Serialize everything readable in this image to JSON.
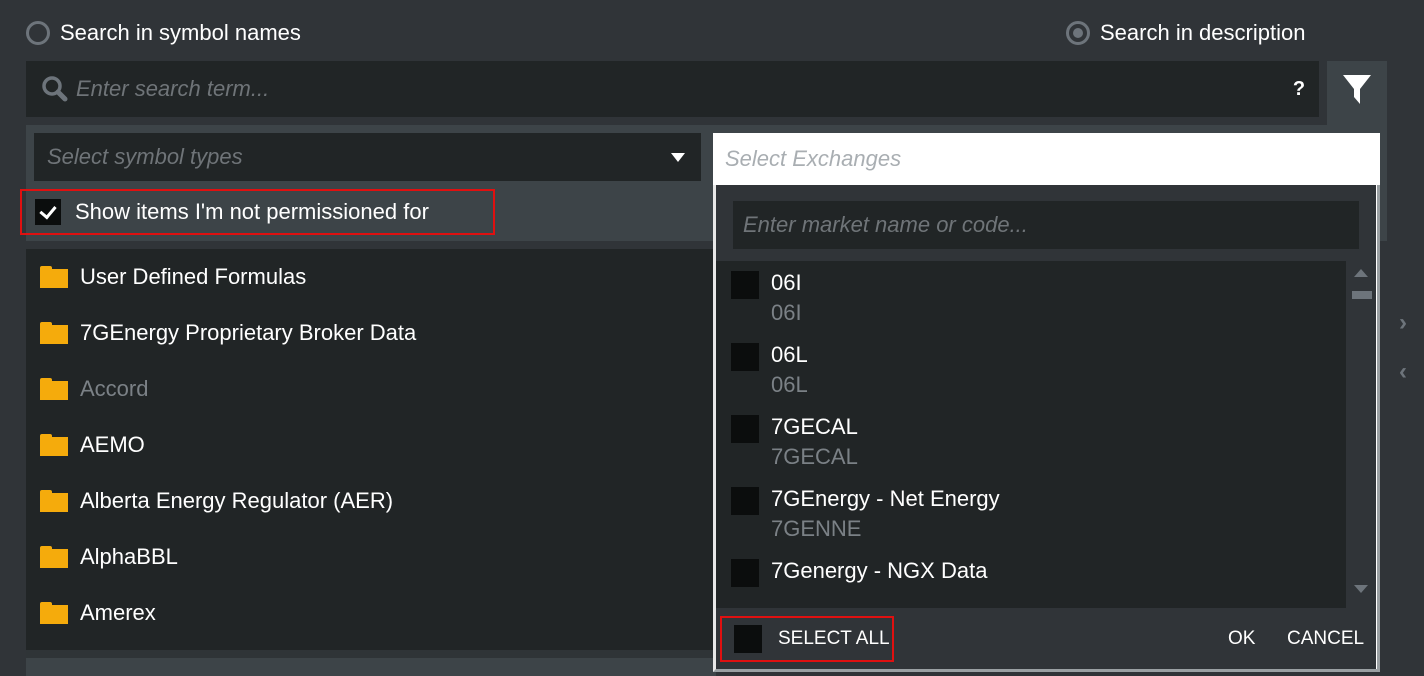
{
  "search_mode": {
    "options": [
      {
        "label": "Search in symbol names",
        "selected": false
      },
      {
        "label": "Search in description",
        "selected": true
      }
    ]
  },
  "search": {
    "placeholder": "Enter search term...",
    "value": "",
    "help_label": "?",
    "search_icon": "search-icon",
    "filter_icon": "filter-icon"
  },
  "filters": {
    "symbol_types_placeholder": "Select symbol types",
    "show_unpermissioned_label": "Show items I'm not permissioned for",
    "show_unpermissioned_checked": true
  },
  "folders": [
    {
      "label": "User Defined Formulas",
      "disabled": false
    },
    {
      "label": "7GEnergy Proprietary Broker Data",
      "disabled": false
    },
    {
      "label": "Accord",
      "disabled": true
    },
    {
      "label": "AEMO",
      "disabled": false
    },
    {
      "label": "Alberta Energy Regulator (AER)",
      "disabled": false
    },
    {
      "label": "AlphaBBL",
      "disabled": false
    },
    {
      "label": "Amerex",
      "disabled": false
    }
  ],
  "exchanges": {
    "placeholder": "Select Exchanges",
    "market_search_placeholder": "Enter market name or code...",
    "items": [
      {
        "name": "06I",
        "code": "06I",
        "checked": false
      },
      {
        "name": "06L",
        "code": "06L",
        "checked": false
      },
      {
        "name": "7GECAL",
        "code": "7GECAL",
        "checked": false
      },
      {
        "name": "7GEnergy - Net Energy",
        "code": "7GENNE",
        "checked": false
      },
      {
        "name": "7Genergy - NGX Data",
        "code": "",
        "checked": false
      }
    ],
    "select_all_label": "SELECT ALL",
    "ok_label": "OK",
    "cancel_label": "CANCEL"
  },
  "side_nav": {
    "next_icon": "chevron-right-icon",
    "prev_icon": "chevron-left-icon",
    "next_glyph": "›",
    "prev_glyph": "‹"
  },
  "colors": {
    "folder": "#f5ab0c",
    "highlight": "#e01010",
    "background": "#303438",
    "panel": "#212526"
  }
}
